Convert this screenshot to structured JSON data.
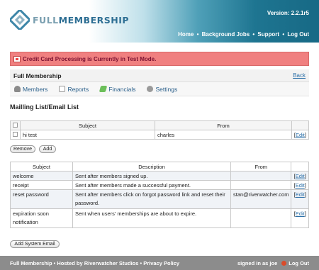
{
  "header": {
    "logo_full": "FULL",
    "logo_mem": "MEMBERSHIP",
    "version": "Version: 2.2.1r5",
    "nav": [
      "Home",
      "Background Jobs",
      "Support",
      "Log Out"
    ]
  },
  "alert": {
    "text": "Credit Card Processing is Currently in Test Mode."
  },
  "titlebar": {
    "title": "Full Membership",
    "back": "Back"
  },
  "subnav": [
    {
      "label": "Members",
      "icon": "user-icon"
    },
    {
      "label": "Reports",
      "icon": "report-icon"
    },
    {
      "label": "Financials",
      "icon": "money-icon"
    },
    {
      "label": "Settings",
      "icon": "gear-icon"
    }
  ],
  "section_title": "Mailling List/Email List",
  "mailing": {
    "headers": [
      "Subject",
      "From"
    ],
    "rows": [
      {
        "subject": "hi test",
        "from": "charles",
        "action": "Edit"
      }
    ],
    "remove_label": "Remove",
    "add_label": "Add"
  },
  "emails": {
    "headers": [
      "Subject",
      "Description",
      "From"
    ],
    "rows": [
      {
        "subject": "welcome",
        "description": "Sent after members signed up.",
        "from": "",
        "action": "Edit"
      },
      {
        "subject": "receipt",
        "description": "Sent after members made a successful payment.",
        "from": "",
        "action": "Edit"
      },
      {
        "subject": "reset password",
        "description": "Sent after members click on forgot password link and reset their password.",
        "from": "stan@riverwatcher.com",
        "action": "Edit"
      },
      {
        "subject": "expiration soon notification",
        "description": "Sent when users' memberships are about to expire.",
        "from": "",
        "action": "Edit"
      }
    ],
    "add_label": "Add System Email"
  },
  "footer": {
    "left": "Full Membership • Hosted by Riverwatcher Studios • Privacy Policy",
    "signed_in": "signed in as joe",
    "logout": "Log Out"
  },
  "colors": {
    "alert_bg": "#f08080",
    "alert_text": "#7a1030",
    "link": "#2a6fa8",
    "footer_bg": "#8c8c8c",
    "header_teal": "#176985"
  }
}
